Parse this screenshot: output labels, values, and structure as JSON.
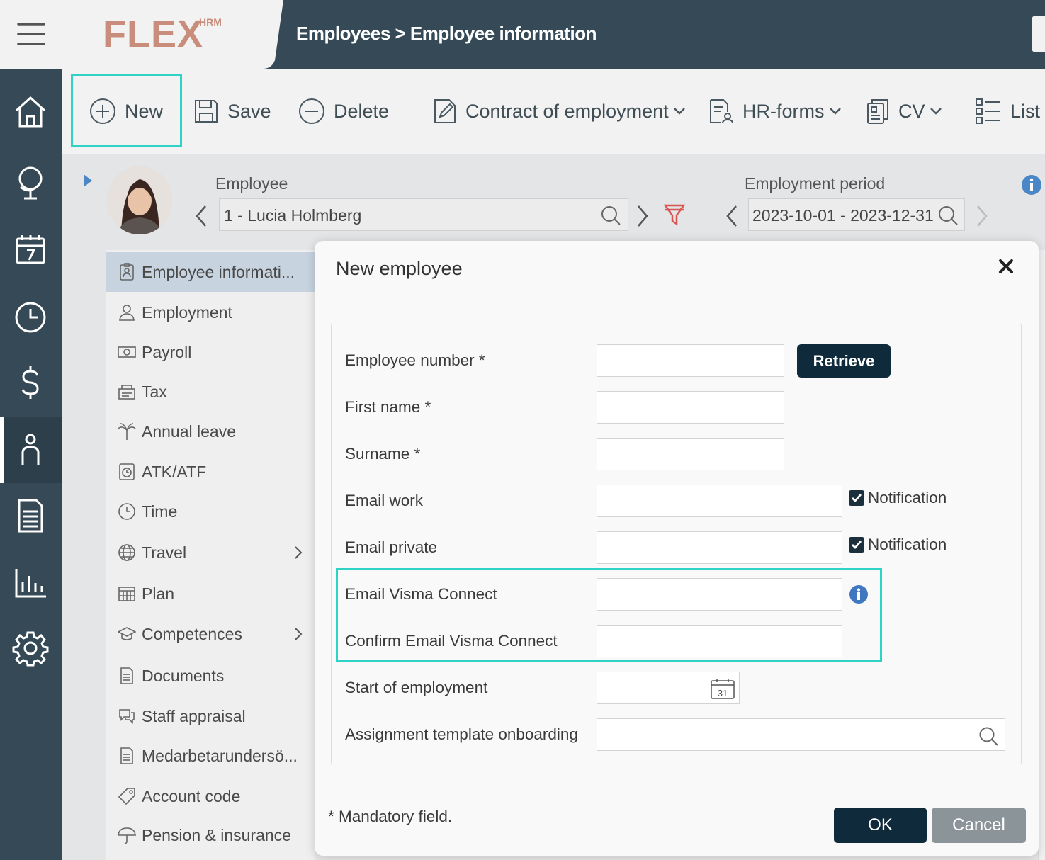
{
  "header": {
    "logo_text": "FLEX",
    "logo_sup": "HRM",
    "breadcrumb": "Employees > Employee information"
  },
  "toolbar": {
    "new_label": "New",
    "save_label": "Save",
    "delete_label": "Delete",
    "contract_label": "Contract of employment",
    "hrforms_label": "HR-forms",
    "cv_label": "CV",
    "list_label": "List"
  },
  "employee": {
    "label": "Employee",
    "value": "1 - Lucia Holmberg",
    "period_label": "Employment period",
    "period_value": "2023-10-01 - 2023-12-31"
  },
  "submenu": {
    "items": [
      {
        "label": "Employee informati...",
        "icon": "id-badge-icon"
      },
      {
        "label": "Employment",
        "icon": "person-icon"
      },
      {
        "label": "Payroll",
        "icon": "banknote-icon"
      },
      {
        "label": "Tax",
        "icon": "tax-icon"
      },
      {
        "label": "Annual leave",
        "icon": "palm-tree-icon"
      },
      {
        "label": "ATK/ATF",
        "icon": "clock-calendar-icon"
      },
      {
        "label": "Time",
        "icon": "clock-icon"
      },
      {
        "label": "Travel",
        "icon": "globe-icon"
      },
      {
        "label": "Plan",
        "icon": "calendar-grid-icon"
      },
      {
        "label": "Competences",
        "icon": "graduation-cap-icon"
      },
      {
        "label": "Documents",
        "icon": "document-icon"
      },
      {
        "label": "Staff appraisal",
        "icon": "chat-bubbles-icon"
      },
      {
        "label": "Medarbetarundersö...",
        "icon": "document-icon"
      },
      {
        "label": "Account code",
        "icon": "tag-icon"
      },
      {
        "label": "Pension & insurance",
        "icon": "umbrella-icon"
      }
    ]
  },
  "modal": {
    "title": "New employee",
    "fields": {
      "employee_number": "Employee number *",
      "first_name": "First name *",
      "surname": "Surname *",
      "email_work": "Email work",
      "email_private": "Email private",
      "email_visma": "Email Visma Connect",
      "confirm_visma": "Confirm Email Visma Connect",
      "start_employment": "Start of employment",
      "assignment_template": "Assignment template onboarding"
    },
    "values": {
      "employee_number": "",
      "first_name": "",
      "surname": "",
      "email_work": "",
      "email_private": "",
      "email_visma": "",
      "confirm_visma": "",
      "start_employment": "",
      "assignment_template": ""
    },
    "retrieve_label": "Retrieve",
    "notification_label": "Notification",
    "notification_work_checked": true,
    "notification_private_checked": true,
    "calendar_day": "31",
    "mandatory_note": "* Mandatory field.",
    "ok_label": "OK",
    "cancel_label": "Cancel"
  },
  "colors": {
    "topbar": "#354a56",
    "accent_highlight": "#2fd3c6",
    "primary_button": "#0f2a3a",
    "secondary_button": "#8a9499",
    "logo": "#c98e7b",
    "filter_icon": "#d9534f"
  }
}
